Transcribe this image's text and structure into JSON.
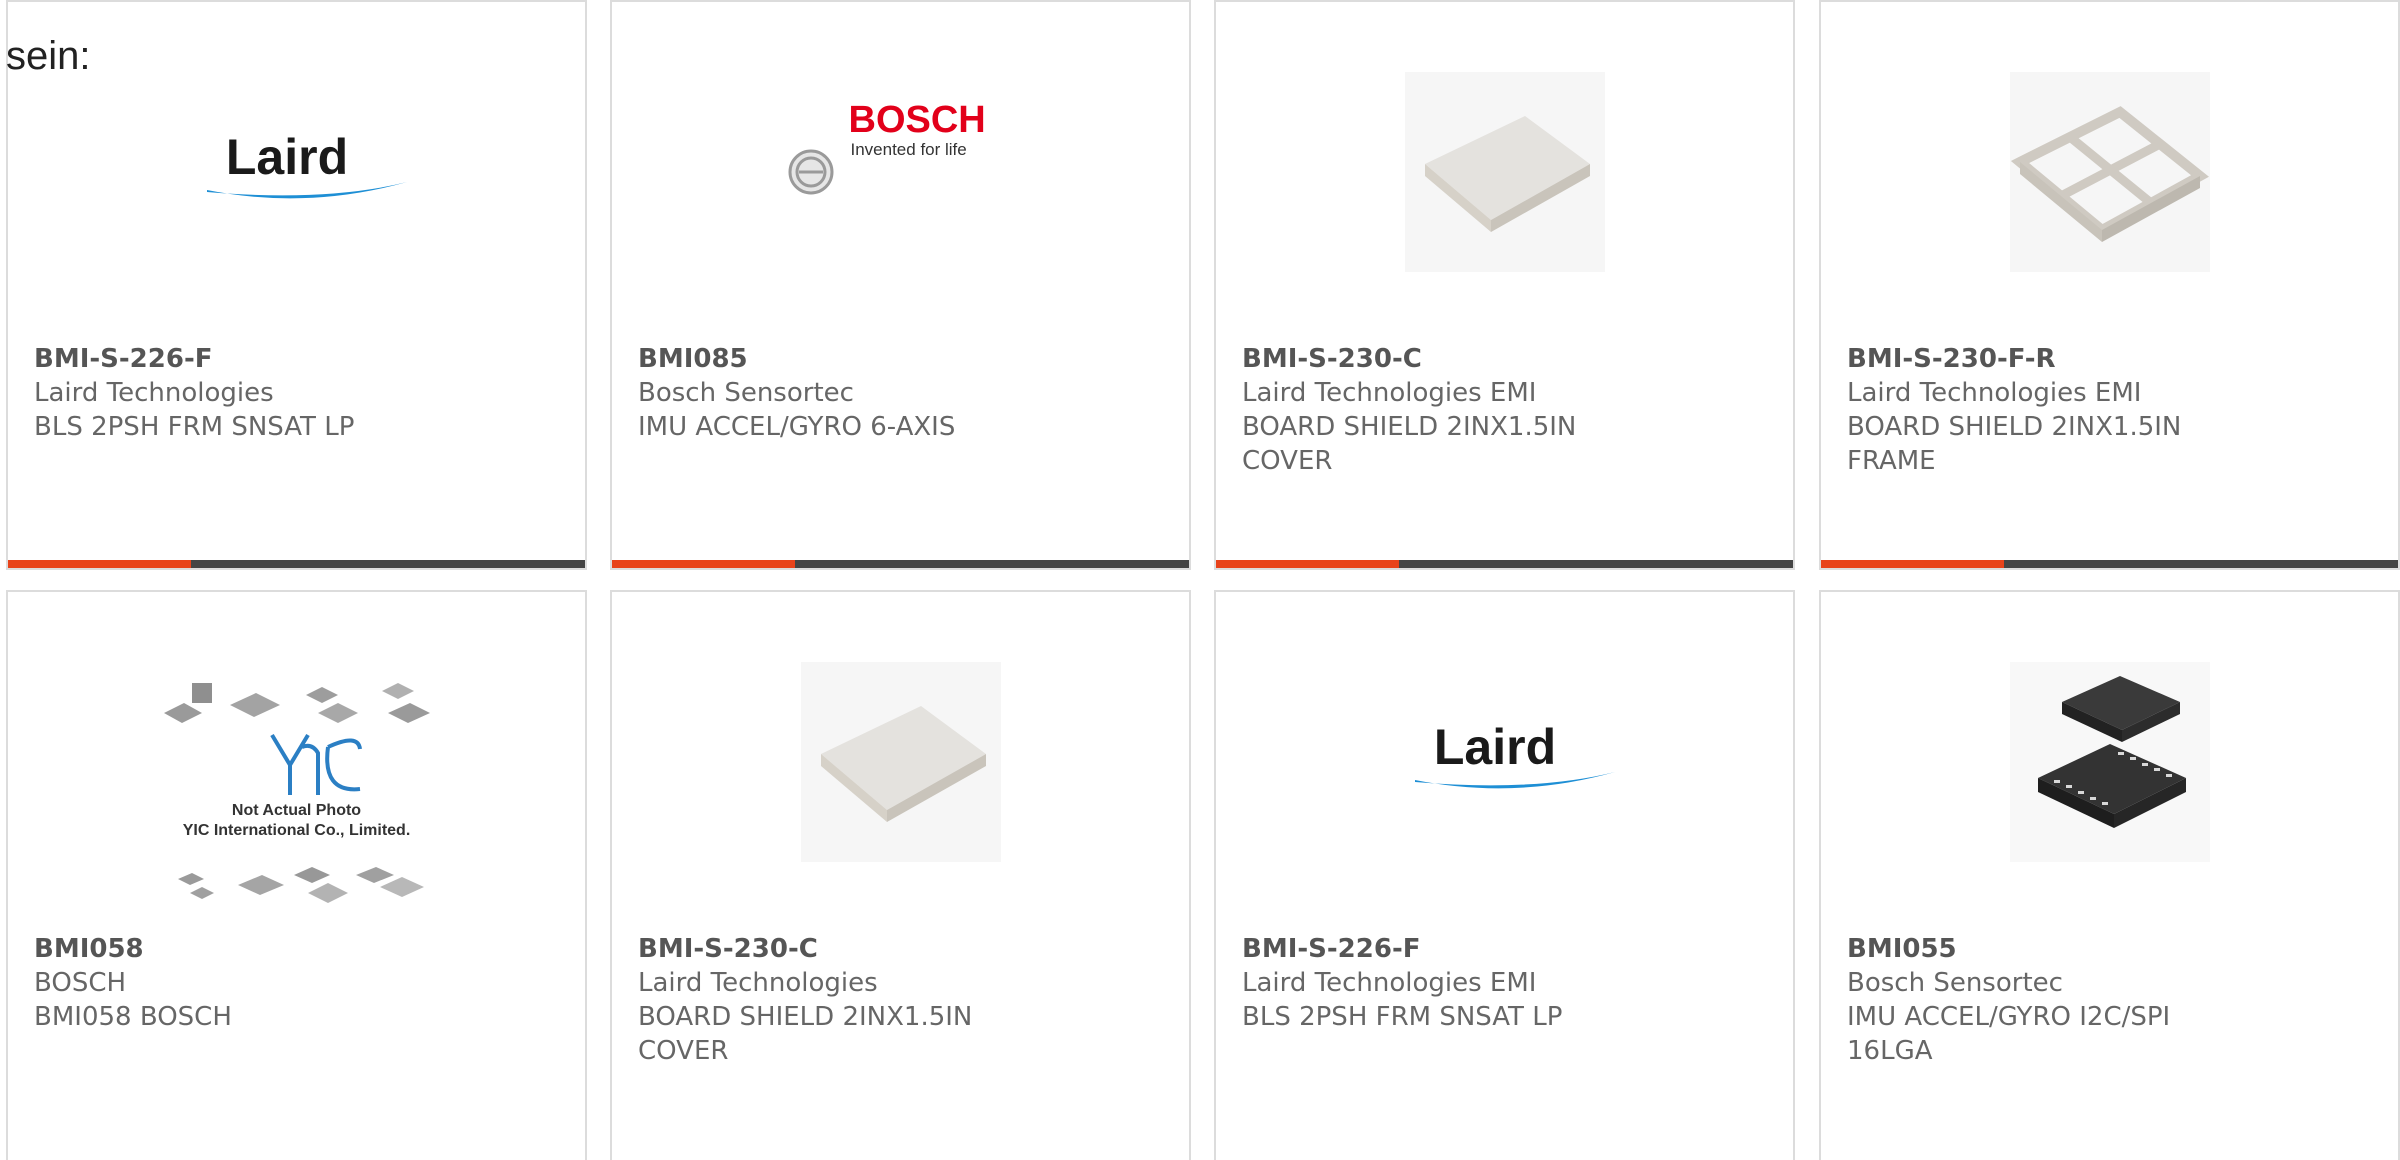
{
  "intro_text": "sein:",
  "colors": {
    "accent": "#e8431a",
    "bar_dark": "#444444",
    "card_border": "#dcdcdc",
    "text": "#555555"
  },
  "products": [
    {
      "part_number": "BMI-S-226-F",
      "manufacturer": "Laird Technologies",
      "description": "BLS 2PSH FRM SNSAT LP",
      "image": "laird-logo"
    },
    {
      "part_number": "BMI085",
      "manufacturer": "Bosch Sensortec",
      "description": "IMU ACCEL/GYRO 6-AXIS",
      "image": "bosch-logo",
      "logo_text": "BOSCH",
      "logo_tagline": "Invented for life"
    },
    {
      "part_number": "BMI-S-230-C",
      "manufacturer": "Laird Technologies EMI",
      "description": "BOARD SHIELD 2INX1.5IN COVER",
      "image": "shield-cover-photo"
    },
    {
      "part_number": "BMI-S-230-F-R",
      "manufacturer": "Laird Technologies EMI",
      "description": "BOARD SHIELD 2INX1.5IN FRAME",
      "image": "shield-frame-photo"
    },
    {
      "part_number": "BMI058",
      "manufacturer": "BOSCH",
      "description": "BMI058 BOSCH",
      "image": "yic-placeholder",
      "placeholder_line1": "Not Actual Photo",
      "placeholder_line2": "YIC International Co., Limited."
    },
    {
      "part_number": "BMI-S-230-C",
      "manufacturer": "Laird Technologies",
      "description": "BOARD SHIELD 2INX1.5IN COVER",
      "image": "shield-cover-photo"
    },
    {
      "part_number": "BMI-S-226-F",
      "manufacturer": "Laird Technologies EMI",
      "description": "BLS 2PSH FRM SNSAT LP",
      "image": "laird-logo"
    },
    {
      "part_number": "BMI055",
      "manufacturer": "Bosch Sensortec",
      "description": "IMU ACCEL/GYRO I2C/SPI 16LGA",
      "image": "lga-chip-photo"
    }
  ]
}
